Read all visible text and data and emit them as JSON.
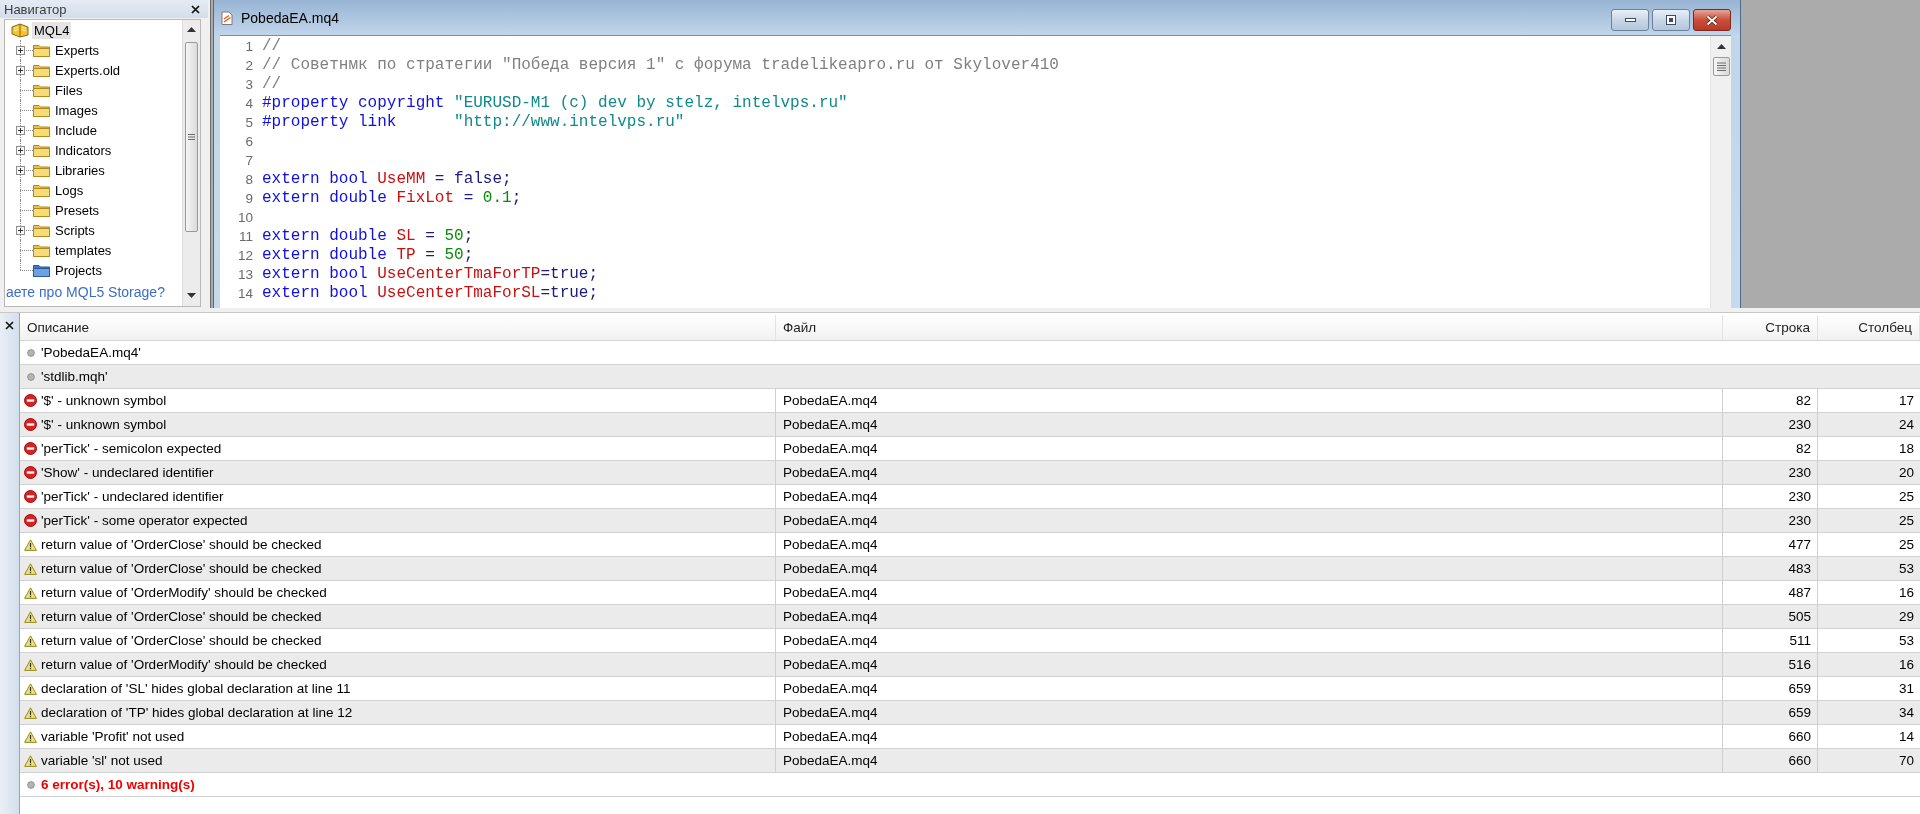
{
  "navigator": {
    "title": "Навигатор",
    "tree": [
      {
        "label": "MQL4",
        "kind": "book",
        "selected": true,
        "children": [
          {
            "label": "Experts",
            "kind": "folder",
            "expandable": true,
            "selected": false
          },
          {
            "label": "Experts.old",
            "kind": "folder",
            "expandable": true,
            "selected": false
          },
          {
            "label": "Files",
            "kind": "folder",
            "expandable": false,
            "selected": false
          },
          {
            "label": "Images",
            "kind": "folder",
            "expandable": false,
            "selected": false
          },
          {
            "label": "Include",
            "kind": "folder",
            "expandable": true,
            "selected": false
          },
          {
            "label": "Indicators",
            "kind": "folder",
            "expandable": true,
            "selected": false
          },
          {
            "label": "Libraries",
            "kind": "folder",
            "expandable": true,
            "selected": false
          },
          {
            "label": "Logs",
            "kind": "folder",
            "expandable": false,
            "selected": false
          },
          {
            "label": "Presets",
            "kind": "folder",
            "expandable": false,
            "selected": false
          },
          {
            "label": "Scripts",
            "kind": "folder",
            "expandable": true,
            "selected": false
          },
          {
            "label": "templates",
            "kind": "folder",
            "expandable": false,
            "selected": false
          },
          {
            "label": "Projects",
            "kind": "project",
            "expandable": false,
            "selected": false
          }
        ]
      }
    ],
    "storage_link": "аете про MQL5 Storage?"
  },
  "editor": {
    "title": "PobedaEA.mq4",
    "lines": [
      {
        "number": "1",
        "tokens": [
          {
            "text": "//",
            "kind": "comment"
          }
        ]
      },
      {
        "number": "2",
        "tokens": [
          {
            "text": "// Советнмк по стратегии \"Победа версия 1\" с форума tradelikeapro.ru от Skylover410",
            "kind": "comment"
          }
        ]
      },
      {
        "number": "3",
        "tokens": [
          {
            "text": "//",
            "kind": "comment"
          }
        ]
      },
      {
        "number": "4",
        "tokens": [
          {
            "text": "#property copyright ",
            "kind": "keyword"
          },
          {
            "text": "\"EURUSD-M1 (c) dev by stelz, intelvps.ru\"",
            "kind": "string"
          }
        ]
      },
      {
        "number": "5",
        "tokens": [
          {
            "text": "#property link      ",
            "kind": "keyword"
          },
          {
            "text": "\"http://www.intelvps.ru\"",
            "kind": "string"
          }
        ]
      },
      {
        "number": "6"
      },
      {
        "number": "7"
      },
      {
        "number": "8",
        "tokens": [
          {
            "text": "extern bool ",
            "kind": "keyword"
          },
          {
            "text": "UseMM",
            "kind": "identifier"
          },
          {
            "text": " = false;",
            "kind": "plain"
          }
        ]
      },
      {
        "number": "9",
        "tokens": [
          {
            "text": "extern double ",
            "kind": "keyword"
          },
          {
            "text": "FixLot",
            "kind": "identifier"
          },
          {
            "text": " = ",
            "kind": "plain"
          },
          {
            "text": "0.1",
            "kind": "number"
          },
          {
            "text": ";",
            "kind": "plain"
          }
        ]
      },
      {
        "number": "10"
      },
      {
        "number": "11",
        "tokens": [
          {
            "text": "extern double ",
            "kind": "keyword"
          },
          {
            "text": "SL",
            "kind": "identifier"
          },
          {
            "text": " = ",
            "kind": "plain"
          },
          {
            "text": "50",
            "kind": "number"
          },
          {
            "text": ";",
            "kind": "plain"
          }
        ]
      },
      {
        "number": "12",
        "tokens": [
          {
            "text": "extern double ",
            "kind": "keyword"
          },
          {
            "text": "TP",
            "kind": "identifier"
          },
          {
            "text": " = ",
            "kind": "plain"
          },
          {
            "text": "50",
            "kind": "number"
          },
          {
            "text": ";",
            "kind": "plain"
          }
        ]
      },
      {
        "number": "13",
        "tokens": [
          {
            "text": "extern bool ",
            "kind": "keyword"
          },
          {
            "text": "UseCenterTmaForTP",
            "kind": "identifier"
          },
          {
            "text": "=true;",
            "kind": "plain"
          }
        ]
      },
      {
        "number": "14",
        "tokens": [
          {
            "text": "extern bool ",
            "kind": "keyword"
          },
          {
            "text": "UseCenterTmaForSL",
            "kind": "identifier"
          },
          {
            "text": "=true;",
            "kind": "plain"
          }
        ]
      }
    ]
  },
  "messages": {
    "columns": [
      "Описание",
      "Файл",
      "Строка",
      "Столбец"
    ],
    "rows": [
      {
        "kind": "file",
        "description": "'PobedaEA.mq4'"
      },
      {
        "kind": "file",
        "description": "'stdlib.mqh'"
      },
      {
        "kind": "error",
        "description": "'$' - unknown symbol",
        "file": "PobedaEA.mq4",
        "line": "82",
        "column": "17"
      },
      {
        "kind": "error",
        "description": "'$' - unknown symbol",
        "file": "PobedaEA.mq4",
        "line": "230",
        "column": "24"
      },
      {
        "kind": "error",
        "description": "'perTick' - semicolon expected",
        "file": "PobedaEA.mq4",
        "line": "82",
        "column": "18"
      },
      {
        "kind": "error",
        "description": "'Show' - undeclared identifier",
        "file": "PobedaEA.mq4",
        "line": "230",
        "column": "20"
      },
      {
        "kind": "error",
        "description": "'perTick' - undeclared identifier",
        "file": "PobedaEA.mq4",
        "line": "230",
        "column": "25"
      },
      {
        "kind": "error",
        "description": "'perTick' - some operator expected",
        "file": "PobedaEA.mq4",
        "line": "230",
        "column": "25"
      },
      {
        "kind": "warning",
        "description": "return value of 'OrderClose' should be checked",
        "file": "PobedaEA.mq4",
        "line": "477",
        "column": "25"
      },
      {
        "kind": "warning",
        "description": "return value of 'OrderClose' should be checked",
        "file": "PobedaEA.mq4",
        "line": "483",
        "column": "53"
      },
      {
        "kind": "warning",
        "description": "return value of 'OrderModify' should be checked",
        "file": "PobedaEA.mq4",
        "line": "487",
        "column": "16"
      },
      {
        "kind": "warning",
        "description": "return value of 'OrderClose' should be checked",
        "file": "PobedaEA.mq4",
        "line": "505",
        "column": "29"
      },
      {
        "kind": "warning",
        "description": "return value of 'OrderClose' should be checked",
        "file": "PobedaEA.mq4",
        "line": "511",
        "column": "53"
      },
      {
        "kind": "warning",
        "description": "return value of 'OrderModify' should be checked",
        "file": "PobedaEA.mq4",
        "line": "516",
        "column": "16"
      },
      {
        "kind": "warning",
        "description": "declaration of 'SL' hides global declaration at line 11",
        "file": "PobedaEA.mq4",
        "line": "659",
        "column": "31"
      },
      {
        "kind": "warning",
        "description": "declaration of 'TP' hides global declaration at line 12",
        "file": "PobedaEA.mq4",
        "line": "659",
        "column": "34"
      },
      {
        "kind": "warning",
        "description": "variable 'Profit' not used",
        "file": "PobedaEA.mq4",
        "line": "660",
        "column": "14"
      },
      {
        "kind": "warning",
        "description": "variable 'sl' not used",
        "file": "PobedaEA.mq4",
        "line": "660",
        "column": "70"
      },
      {
        "kind": "summary",
        "description": "6 error(s), 10 warning(s)"
      }
    ]
  }
}
